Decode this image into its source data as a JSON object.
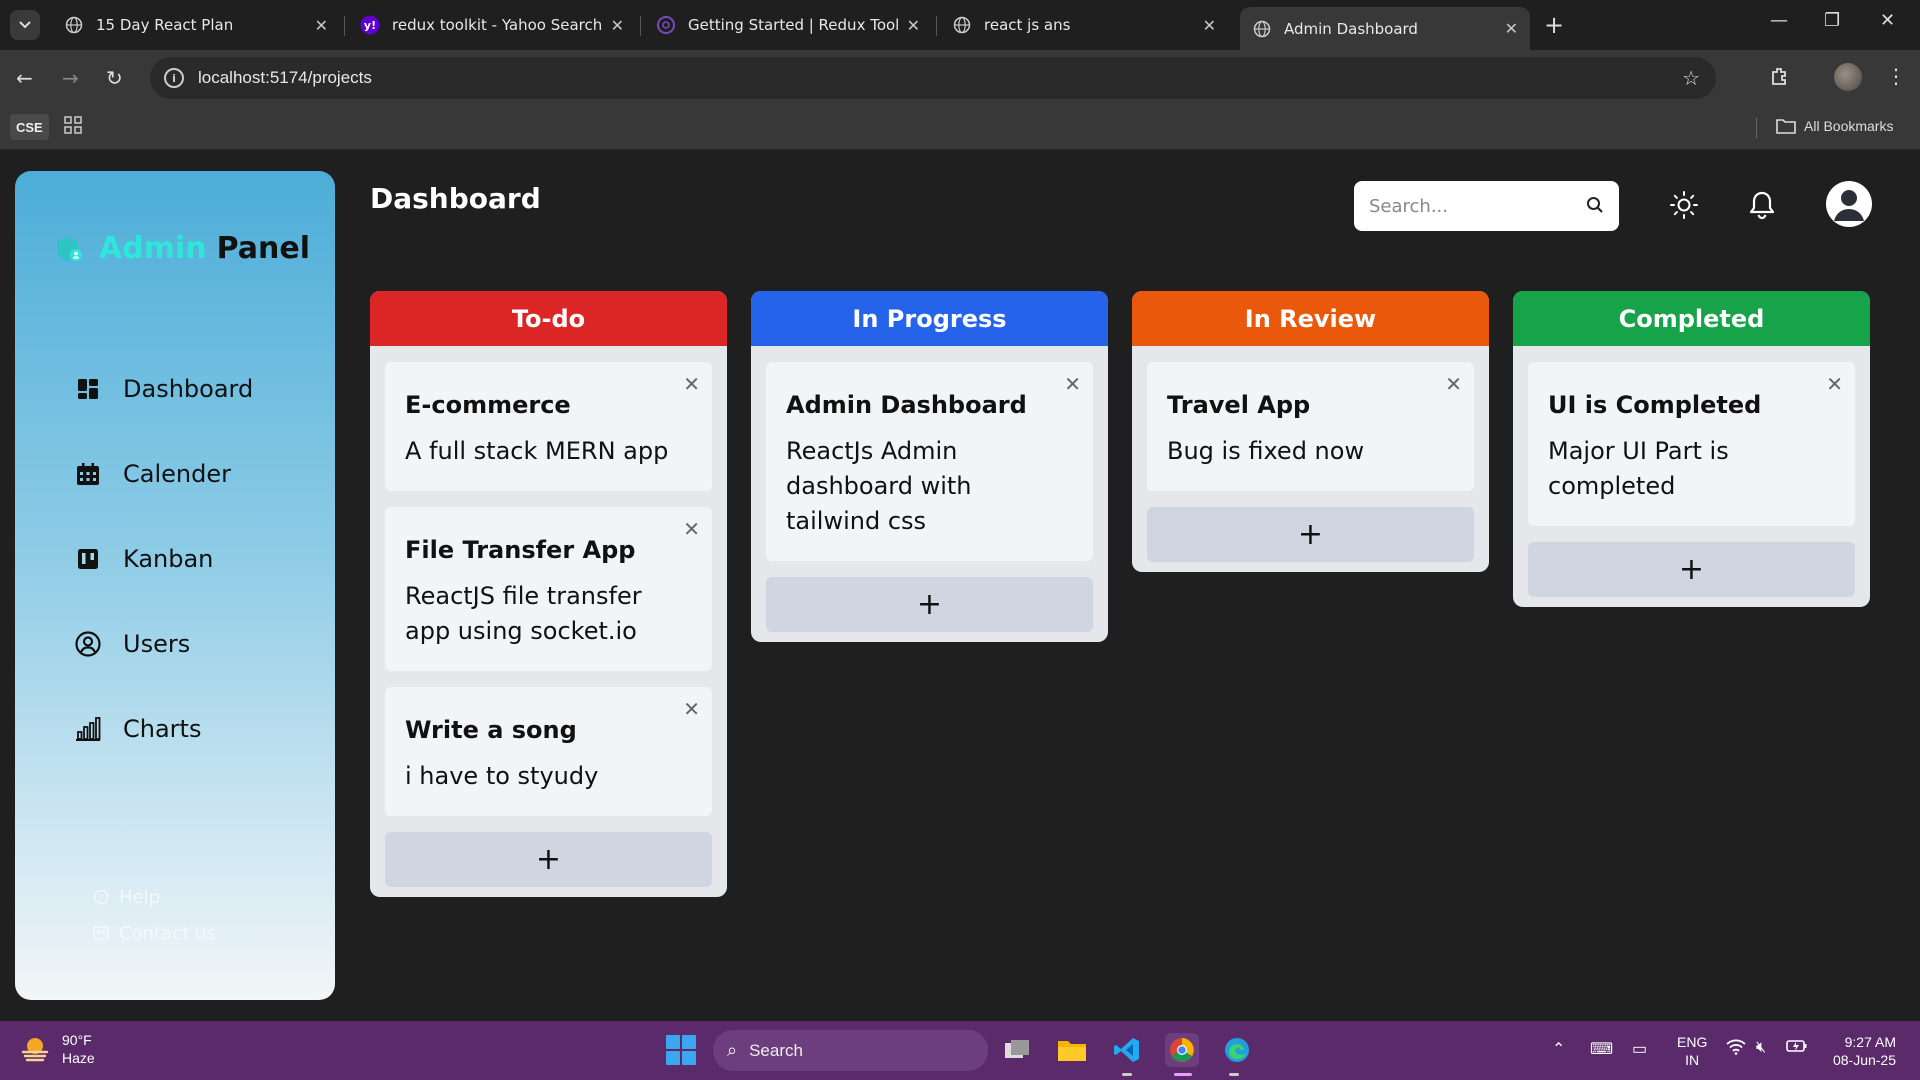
{
  "browser": {
    "tabs": [
      {
        "label": "15 Day React Plan",
        "icon": "globe-icon",
        "active": false
      },
      {
        "label": "redux toolkit - Yahoo Search Re",
        "icon": "yahoo-icon",
        "active": false
      },
      {
        "label": "Getting Started | Redux Toolkit",
        "icon": "redux-icon",
        "active": false
      },
      {
        "label": "react js ans",
        "icon": "globe-icon",
        "active": false
      },
      {
        "label": "Admin Dashboard",
        "icon": "globe-icon",
        "active": true
      }
    ],
    "url": "localhost:5174/projects",
    "bookmarks": {
      "cse_label": "CSE",
      "all_bookmarks_label": "All Bookmarks"
    }
  },
  "sidebar": {
    "brand_part1": "Admin",
    "brand_part2": "Panel",
    "items": [
      {
        "label": "Dashboard",
        "icon": "dashboard-icon"
      },
      {
        "label": "Calender",
        "icon": "calendar-icon"
      },
      {
        "label": "Kanban",
        "icon": "kanban-icon"
      },
      {
        "label": "Users",
        "icon": "user-circle-icon"
      },
      {
        "label": "Charts",
        "icon": "bar-chart-icon"
      }
    ],
    "footer": [
      {
        "label": "Help",
        "icon": "help-icon"
      },
      {
        "label": "Contact us",
        "icon": "contact-icon"
      }
    ]
  },
  "header": {
    "title": "Dashboard",
    "search_placeholder": "Search..."
  },
  "kanban": {
    "columns": [
      {
        "title": "To-do",
        "color": "#dc2626",
        "cards": [
          {
            "title": "E-commerce",
            "description": "A full stack MERN app"
          },
          {
            "title": "File Transfer App",
            "description": "ReactJS file transfer app using socket.io"
          },
          {
            "title": "Write a song",
            "description": "i have to styudy"
          }
        ]
      },
      {
        "title": "In Progress",
        "color": "#2563eb",
        "cards": [
          {
            "title": "Admin Dashboard",
            "description": "ReactJs Admin dashboard with tailwind css"
          }
        ]
      },
      {
        "title": "In Review",
        "color": "#ea580c",
        "cards": [
          {
            "title": "Travel App",
            "description": "Bug is fixed now"
          }
        ]
      },
      {
        "title": "Completed",
        "color": "#16a34a",
        "cards": [
          {
            "title": "UI is Completed",
            "description": "Major UI Part is completed"
          }
        ]
      }
    ],
    "add_label": "+",
    "close_label": "✕"
  },
  "taskbar": {
    "weather_temp": "90°F",
    "weather_desc": "Haze",
    "search_label": "Search",
    "lang_line1": "ENG",
    "lang_line2": "IN",
    "time": "9:27 AM",
    "date": "08-Jun-25"
  }
}
